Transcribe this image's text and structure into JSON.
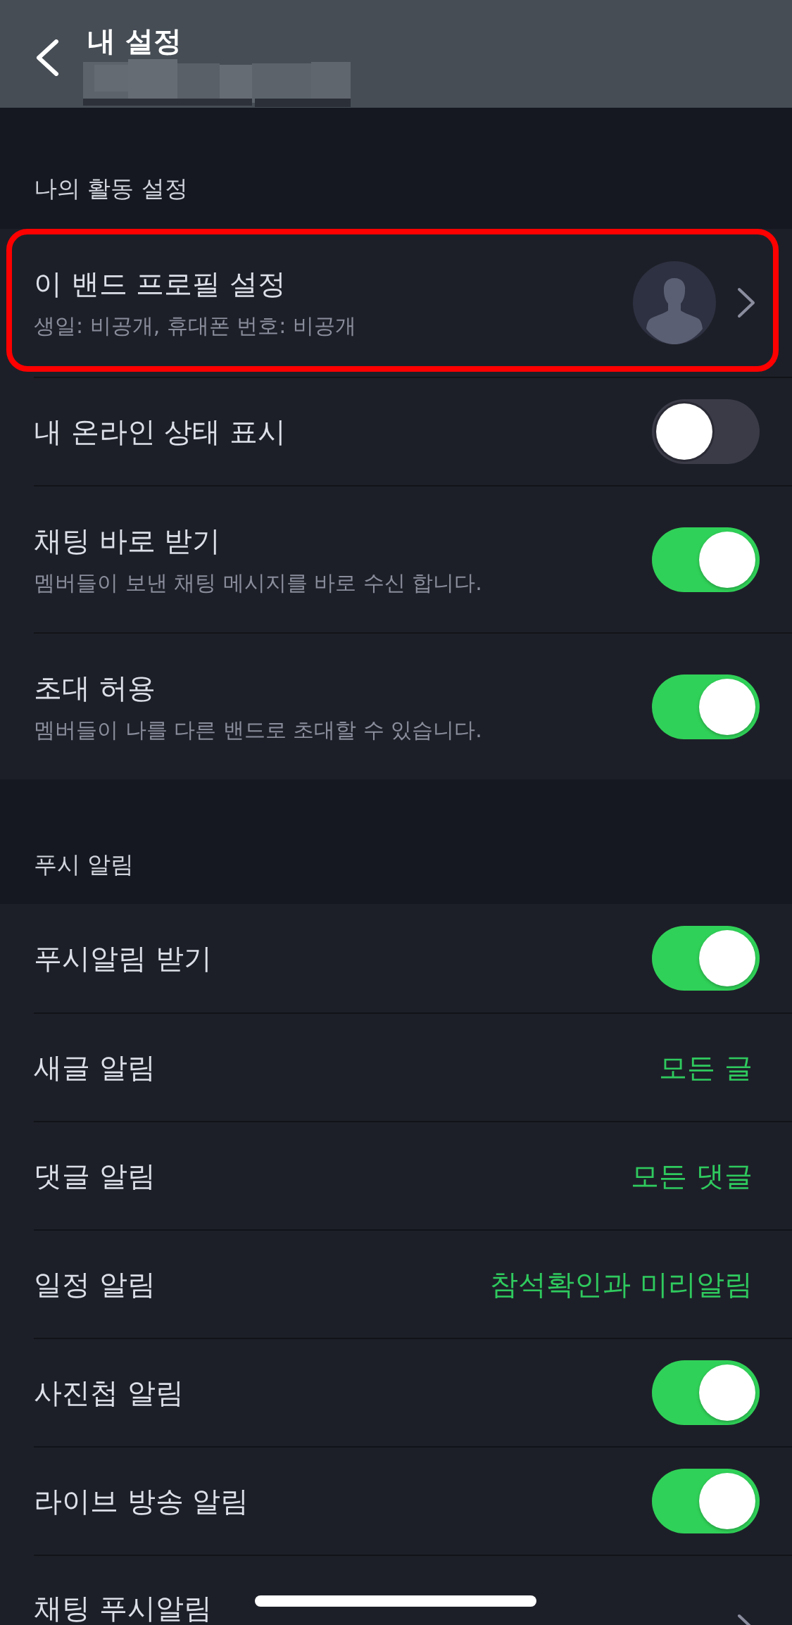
{
  "header": {
    "title": "내 설정"
  },
  "sections": [
    {
      "title": "나의 활동 설정",
      "items": [
        {
          "kind": "profile",
          "title": "이 밴드 프로필 설정",
          "subtitle": "생일: 비공개, 휴대폰 번호: 비공개",
          "highlighted": true
        },
        {
          "kind": "toggle",
          "title": "내 온라인 상태 표시",
          "on": false,
          "highlighted": false
        },
        {
          "kind": "toggle",
          "title": "채팅 바로 받기",
          "subtitle": "멤버들이 보낸 채팅 메시지를 바로 수신 합니다.",
          "on": true,
          "highlighted": false
        },
        {
          "kind": "toggle",
          "title": "초대 허용",
          "subtitle": "멤버들이 나를 다른 밴드로 초대할 수 있습니다.",
          "on": true,
          "highlighted": false
        }
      ]
    },
    {
      "title": "푸시 알림",
      "items": [
        {
          "kind": "toggle",
          "title": "푸시알림 받기",
          "on": true,
          "highlighted": false
        },
        {
          "kind": "value",
          "title": "새글 알림",
          "value": "모든 글",
          "highlighted": false
        },
        {
          "kind": "value",
          "title": "댓글 알림",
          "value": "모든 댓글",
          "highlighted": false
        },
        {
          "kind": "value",
          "title": "일정 알림",
          "value": "참석확인과 미리알림",
          "highlighted": false
        },
        {
          "kind": "toggle",
          "title": "사진첩 알림",
          "on": true,
          "highlighted": false
        },
        {
          "kind": "toggle",
          "title": "라이브 방송 알림",
          "on": true,
          "highlighted": false
        },
        {
          "kind": "link",
          "title": "채팅 푸시알림",
          "highlighted": false
        }
      ]
    }
  ]
}
